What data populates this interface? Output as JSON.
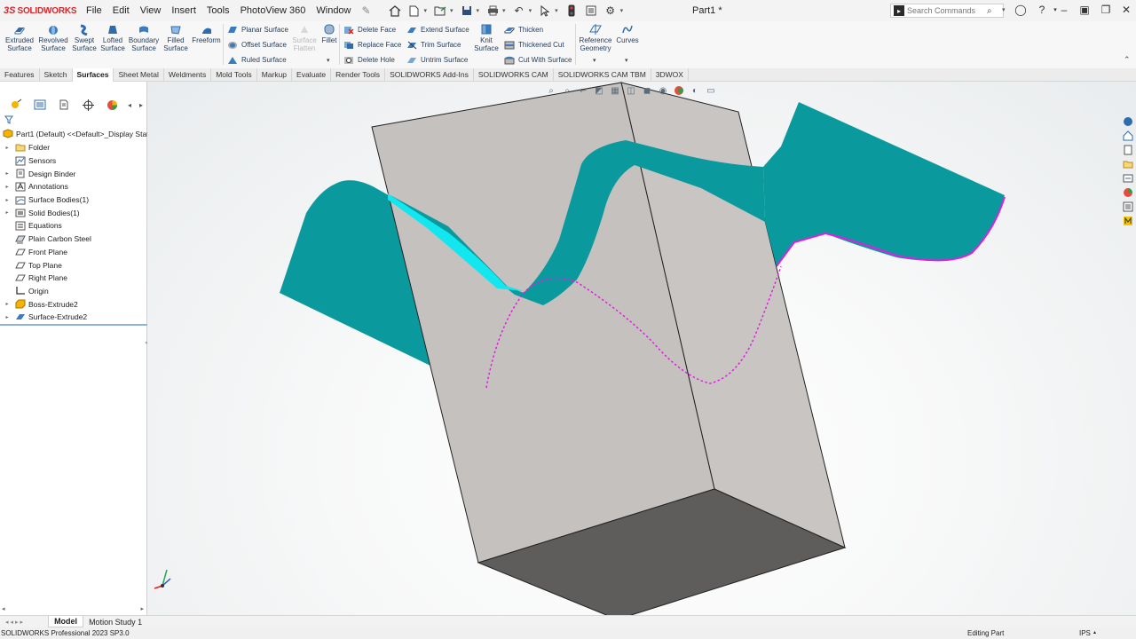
{
  "app": {
    "logo_text": "SOLIDWORKS",
    "doc_title": "Part1 *"
  },
  "menu": [
    "File",
    "Edit",
    "View",
    "Insert",
    "Tools",
    "PhotoView 360",
    "Window"
  ],
  "search": {
    "placeholder": "Search Commands"
  },
  "ribbon": {
    "big": [
      {
        "l1": "Extruded",
        "l2": "Surface"
      },
      {
        "l1": "Revolved",
        "l2": "Surface"
      },
      {
        "l1": "Swept",
        "l2": "Surface"
      },
      {
        "l1": "Lofted",
        "l2": "Surface"
      },
      {
        "l1": "Boundary",
        "l2": "Surface"
      },
      {
        "l1": "Filled",
        "l2": "Surface"
      },
      {
        "l1": "Freeform",
        "l2": ""
      }
    ],
    "planar": "Planar Surface",
    "offset": "Offset Surface",
    "ruled": "Ruled Surface",
    "flatten1": "Surface",
    "flatten2": "Flatten",
    "fillet": "Fillet",
    "delete_face": "Delete Face",
    "replace_face": "Replace Face",
    "delete_hole": "Delete Hole",
    "extend": "Extend Surface",
    "trim": "Trim Surface",
    "untrim": "Untrim Surface",
    "knit1": "Knit",
    "knit2": "Surface",
    "thicken": "Thicken",
    "thickened_cut": "Thickened Cut",
    "cut_with_surface": "Cut With Surface",
    "ref1": "Reference",
    "ref2": "Geometry",
    "curves": "Curves"
  },
  "tabs": [
    "Features",
    "Sketch",
    "Surfaces",
    "Sheet Metal",
    "Weldments",
    "Mold Tools",
    "Markup",
    "Evaluate",
    "Render Tools",
    "SOLIDWORKS Add-Ins",
    "SOLIDWORKS CAM",
    "SOLIDWORKS CAM TBM",
    "3DWOX"
  ],
  "tree": {
    "root": "Part1 (Default) <<Default>_Display State",
    "items": [
      {
        "label": "Folder",
        "arrow": true
      },
      {
        "label": "Sensors",
        "arrow": false
      },
      {
        "label": "Design Binder",
        "arrow": true
      },
      {
        "label": "Annotations",
        "arrow": true
      },
      {
        "label": "Surface Bodies(1)",
        "arrow": true
      },
      {
        "label": "Solid Bodies(1)",
        "arrow": true
      },
      {
        "label": "Equations",
        "arrow": false
      },
      {
        "label": "Plain Carbon Steel",
        "arrow": false
      },
      {
        "label": "Front Plane",
        "arrow": false
      },
      {
        "label": "Top Plane",
        "arrow": false
      },
      {
        "label": "Right Plane",
        "arrow": false
      },
      {
        "label": "Origin",
        "arrow": false
      },
      {
        "label": "Boss-Extrude2",
        "arrow": true
      },
      {
        "label": "Surface-Extrude2",
        "arrow": true
      }
    ]
  },
  "bottom_tabs": [
    "Model",
    "Motion Study 1"
  ],
  "status": {
    "left": "SOLIDWORKS Professional 2023 SP3.0",
    "mode": "Editing Part",
    "units": "IPS"
  },
  "colors": {
    "surface": "#0a9a9e",
    "surface_highlight": "#12e6ef",
    "sketch": "#e01ee0",
    "body": "#c9c5c3",
    "body_bottom": "#5f5d5b"
  }
}
